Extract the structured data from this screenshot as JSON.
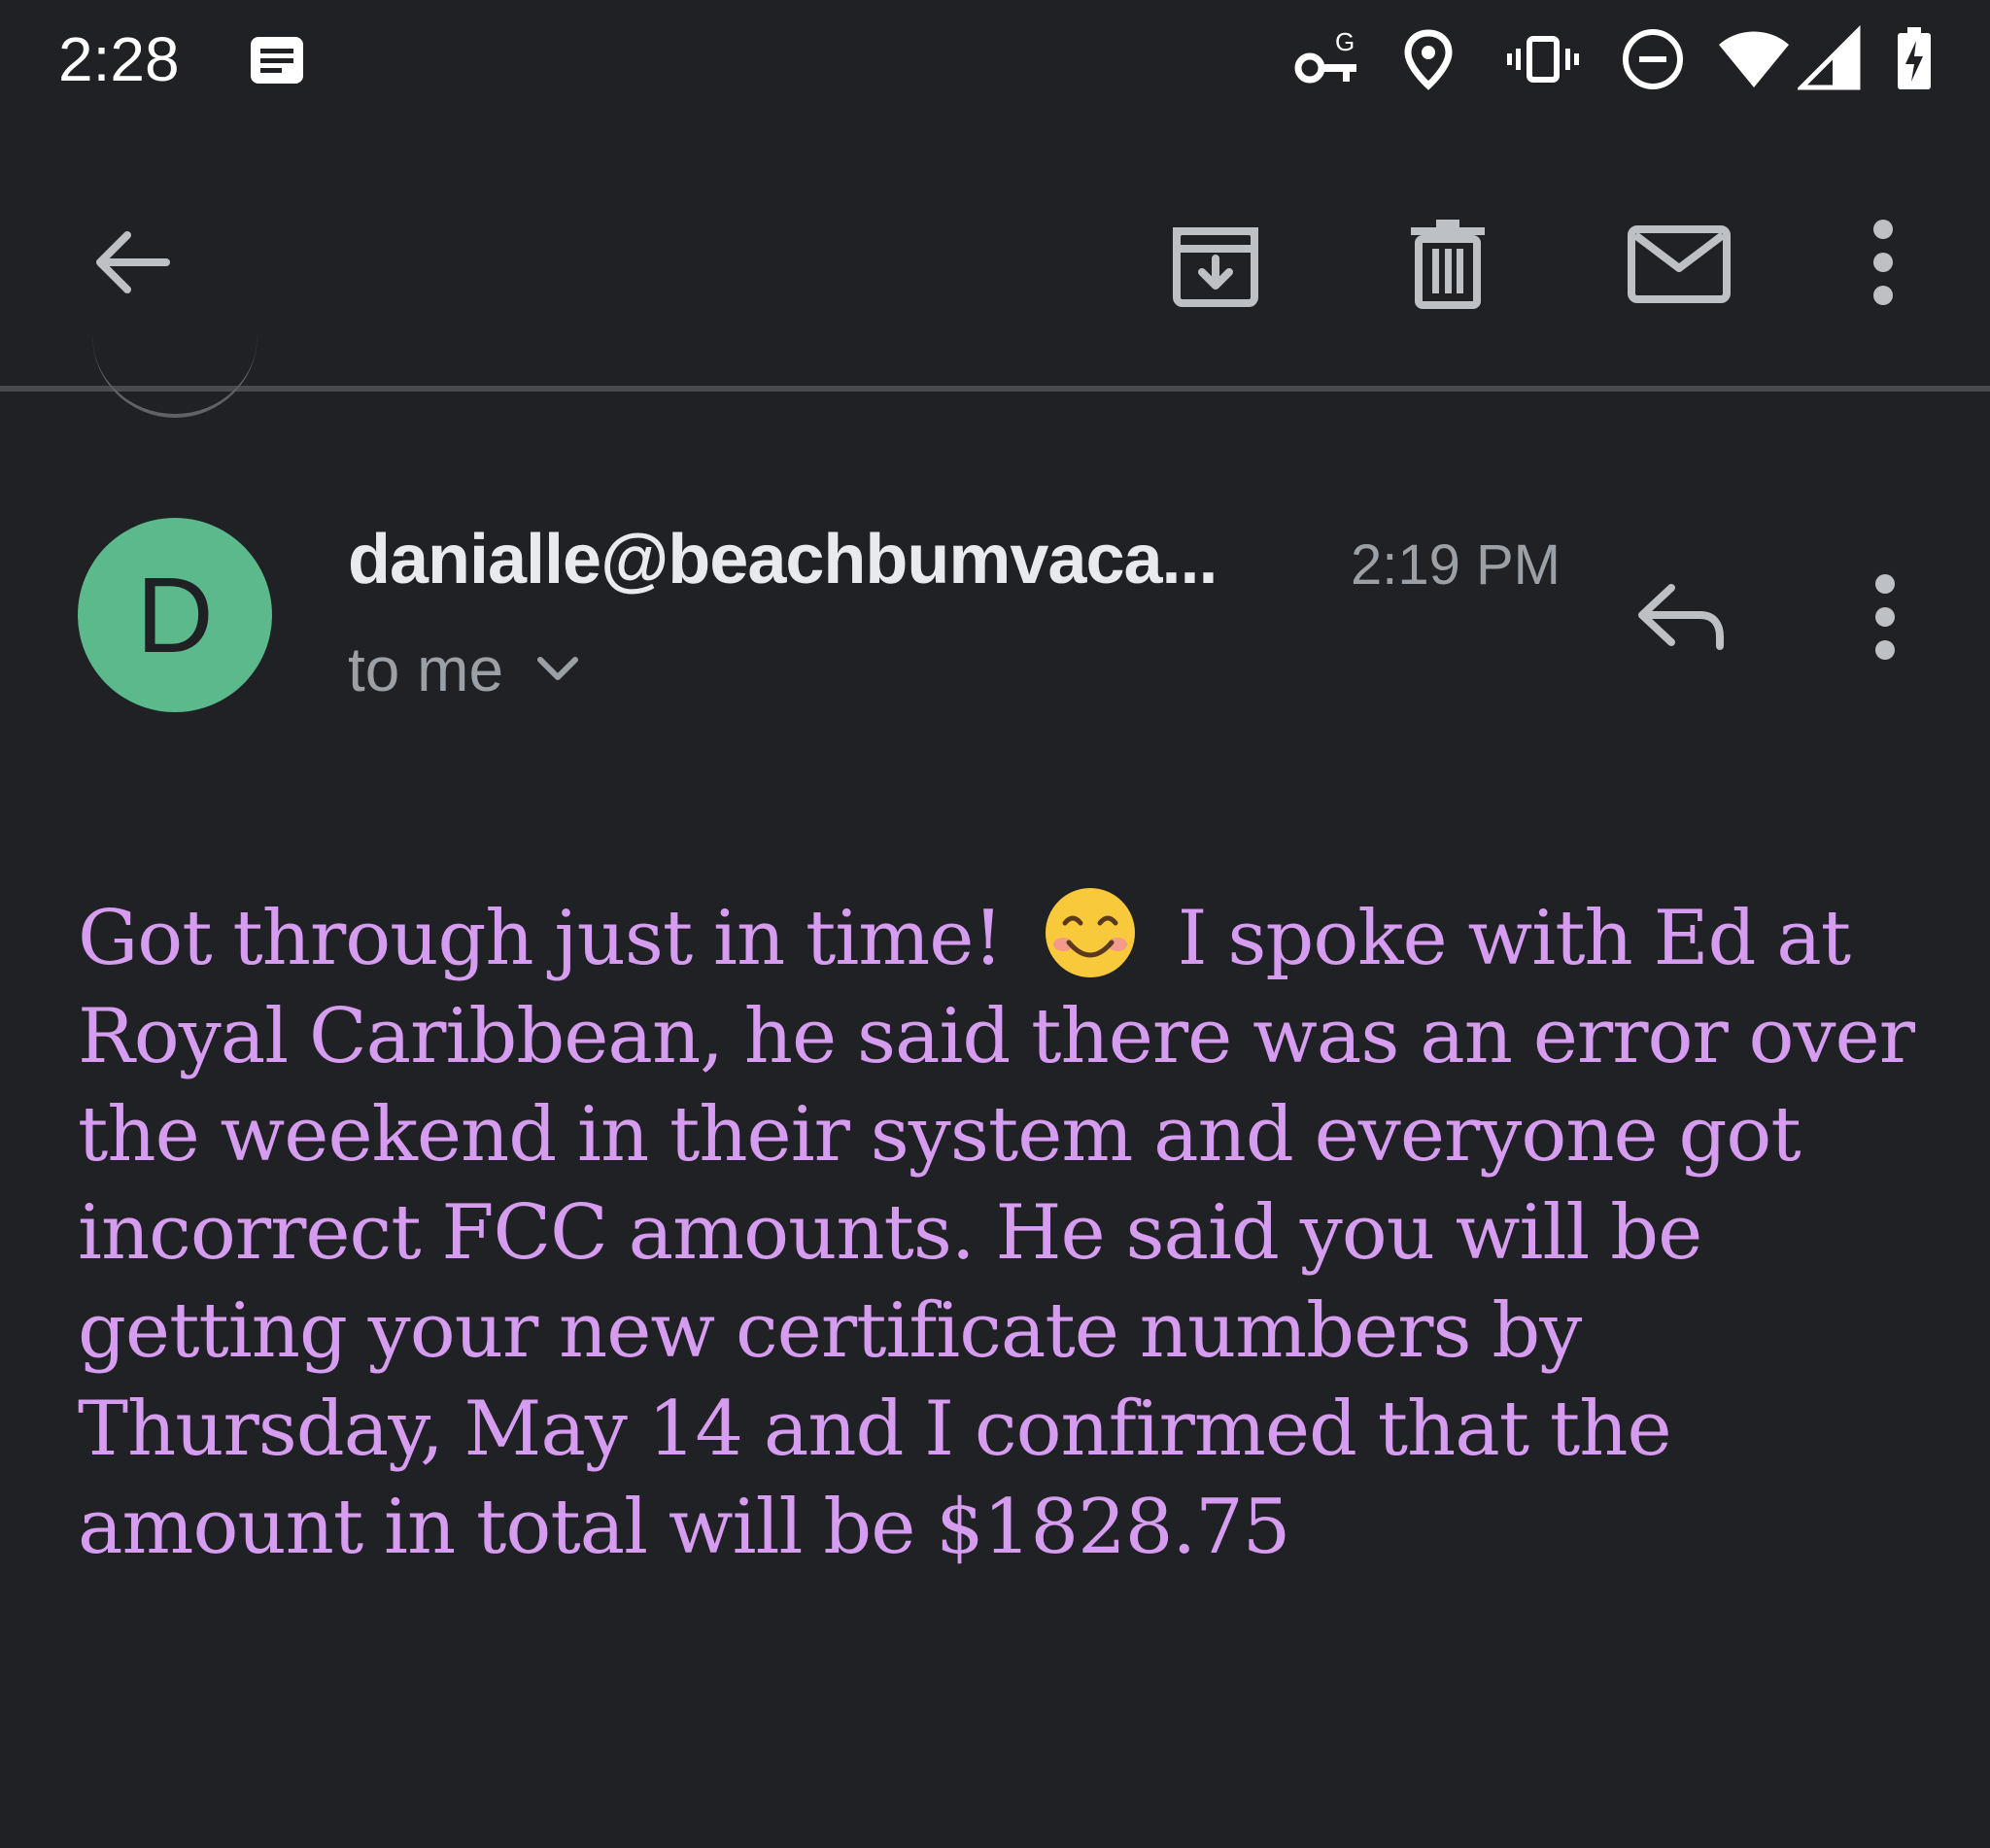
{
  "status_bar": {
    "time": "2:28",
    "icons": [
      "notification-icon",
      "vpn-key-icon",
      "location-icon",
      "vibrate-icon",
      "do-not-disturb-icon",
      "wifi-icon",
      "cellular-signal-icon",
      "battery-charging-icon"
    ]
  },
  "toolbar": {
    "icons": [
      "back-arrow-icon",
      "archive-icon",
      "delete-icon",
      "mark-unread-icon",
      "more-options-icon"
    ]
  },
  "message": {
    "avatar_letter": "D",
    "avatar_color": "#5bb98b",
    "sender": "danialle@beachbumvaca...",
    "time": "2:19 PM",
    "recipient": "to me",
    "body_part1": "Got through just in time!",
    "emoji": "smiling-face-emoji",
    "body_part2": "I spoke with Ed at Royal Caribbean, he said there was an error over the weekend in their system and everyone got incorrect FCC amounts.  He said you will be getting your new certificate numbers by Thursday, May 14 and I confirmed that the amount in total will be $1828.75",
    "body_color": "#d69cf0"
  }
}
